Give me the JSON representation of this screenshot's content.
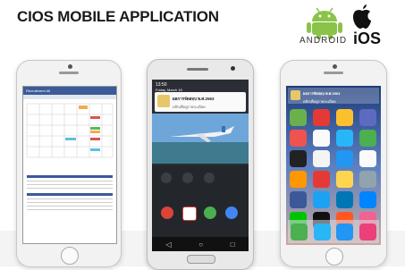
{
  "header": {
    "title": "CIOS MOBILE APPLICATION"
  },
  "platforms": {
    "android_label": "ANDROID",
    "ios_label": "iOS"
  },
  "phone1": {
    "app_name": "Recruitment All"
  },
  "phone2": {
    "status_time": "13:50",
    "status_date": "Friday, March 18",
    "notification_title": "ผลการจัดสอบ พ.ศ.2563",
    "notification_body": "คลิกเพื่อดูรายละเอียด"
  },
  "phone3": {
    "notification_title": "ผลการจัดสอบ พ.ศ.2563",
    "notification_body": "คลิกเพื่อดูรายละเอียด"
  },
  "colors": {
    "android_green": "#8bc34a",
    "ios_blue": "#1e3c7a",
    "app_header": "#3b5a98"
  },
  "icons": [
    "android-logo-icon",
    "apple-logo-icon"
  ]
}
